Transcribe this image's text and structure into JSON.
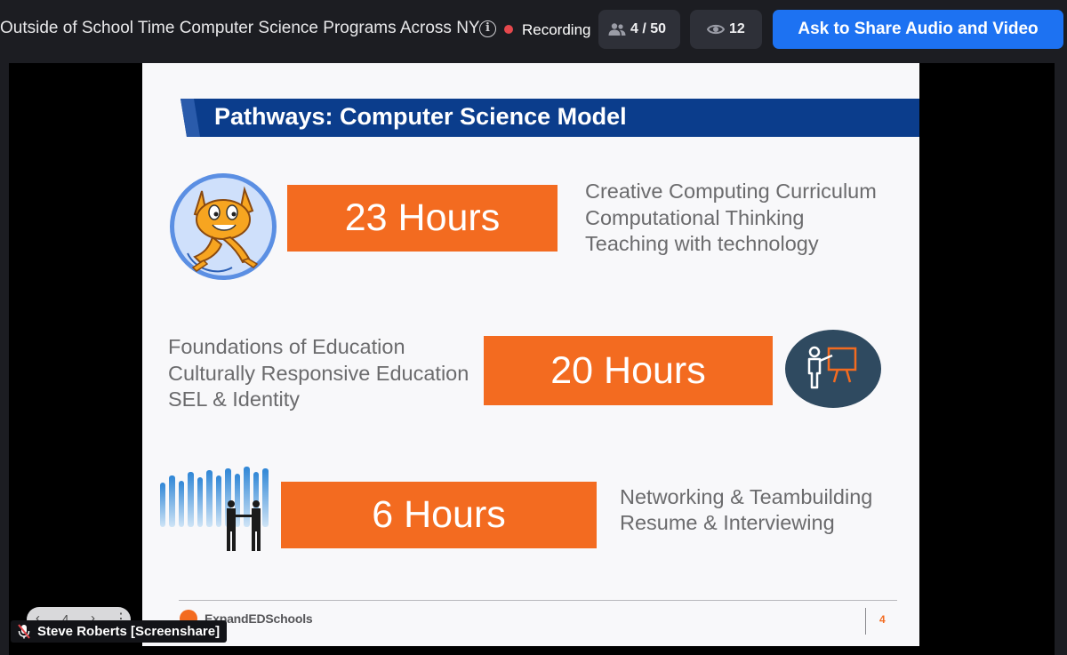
{
  "topbar": {
    "meeting_title": "Outside of School Time Computer Science Programs Across NY",
    "recording_label": "Recording",
    "participants_count": "4 / 50",
    "viewers_count": "12",
    "share_button_label": "Ask to Share Audio and Video",
    "colors": {
      "accent": "#1d72f2",
      "recording": "#e5484d"
    }
  },
  "slide": {
    "title": "Pathways: Computer Science Model",
    "sections": [
      {
        "hours": "23 Hours",
        "topics": [
          "Creative Computing Curriculum",
          "Computational Thinking",
          "Teaching with technology"
        ],
        "image": "scratch-cat"
      },
      {
        "hours": "20 Hours",
        "topics": [
          "Foundations of Education",
          "Culturally Responsive Education",
          "SEL & Identity"
        ],
        "image": "teacher-icon"
      },
      {
        "hours": "6 Hours",
        "topics": [
          "Networking & Teambuilding",
          "Resume & Interviewing"
        ],
        "image": "business-people"
      }
    ],
    "logo_text": "ExpandEDSchools",
    "page_number": "4",
    "colors": {
      "hours_box": "#f36b20",
      "header_bar": "#0b3d8c"
    }
  },
  "slide_nav": {
    "page": "4"
  },
  "presenter": {
    "name": "Steve Roberts [Screenshare]"
  }
}
